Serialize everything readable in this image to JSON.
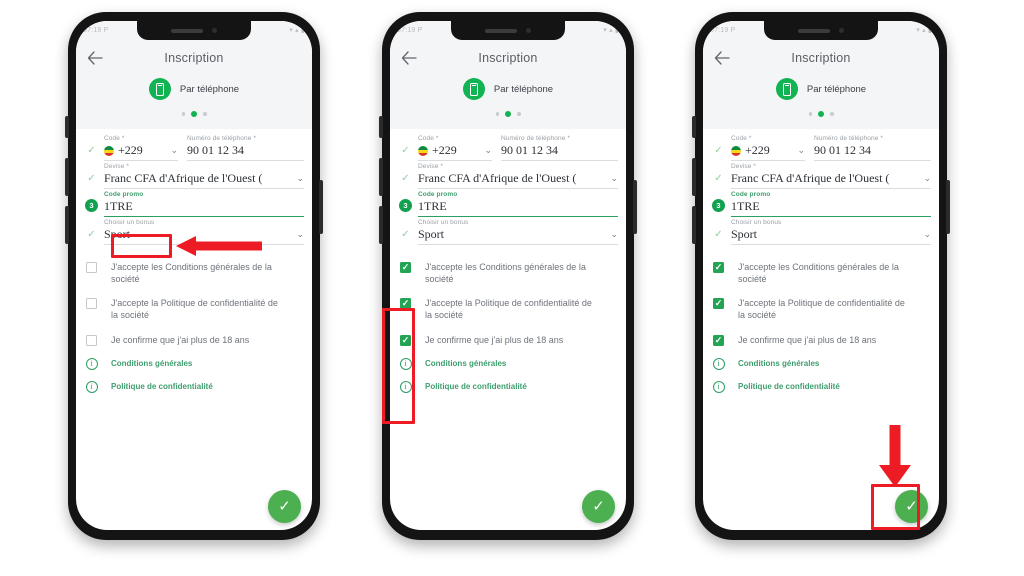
{
  "meta": {
    "page_background": "#ffffff",
    "accent_green": "#2e9e63",
    "fab_green": "#4caf50",
    "checkbox_green": "#23a455",
    "annotation_red": "#ed1c24"
  },
  "status_bar": {
    "time": "07:19",
    "left_glyphs": "P",
    "right_glyphs": "▾ ▴ ▮"
  },
  "app": {
    "back_icon": "back-arrow-icon",
    "title": "Inscription",
    "method": {
      "icon": "phone-icon",
      "label": "Par téléphone"
    },
    "pager": {
      "dots": 3,
      "active_index": 1
    }
  },
  "form": {
    "code_label": "Code *",
    "code_value": "+229",
    "code_flag": "benin-flag-icon",
    "phone_label": "Numéro de téléphone *",
    "phone_value": "90 01 12 34",
    "currency_label": "Devise *",
    "currency_value": "Franc CFA d'Afrique de l'Ouest (",
    "promo_label": "Code promo",
    "promo_value": "1TRE",
    "bonus_label": "Choisir un bonus",
    "bonus_value": "Sport",
    "step_number": "3",
    "check_icon": "check-icon",
    "chevron_icon": "chevron-down-icon"
  },
  "consents": [
    {
      "text": "J'accepte les Conditions générales de la société"
    },
    {
      "text": "J'accepte la Politique de confidentialité de la société"
    },
    {
      "text": "Je confirme que j'ai plus de 18 ans"
    }
  ],
  "links": [
    {
      "icon": "info-icon",
      "text": "Conditions générales"
    },
    {
      "icon": "info-icon",
      "text": "Politique de confidentialité"
    }
  ],
  "submit": {
    "icon": "check-icon",
    "label": "✓"
  },
  "panels": [
    {
      "id": "panel-1",
      "checkbox_states": [
        false,
        false,
        false
      ],
      "highlight": "promo-code-field",
      "arrow": "left-pointing-arrow"
    },
    {
      "id": "panel-2",
      "checkbox_states": [
        true,
        true,
        true
      ],
      "highlight": "consent-checkbox-group",
      "arrow": "none"
    },
    {
      "id": "panel-3",
      "checkbox_states": [
        true,
        true,
        true
      ],
      "highlight": "submit-button",
      "arrow": "down-pointing-arrow"
    }
  ]
}
